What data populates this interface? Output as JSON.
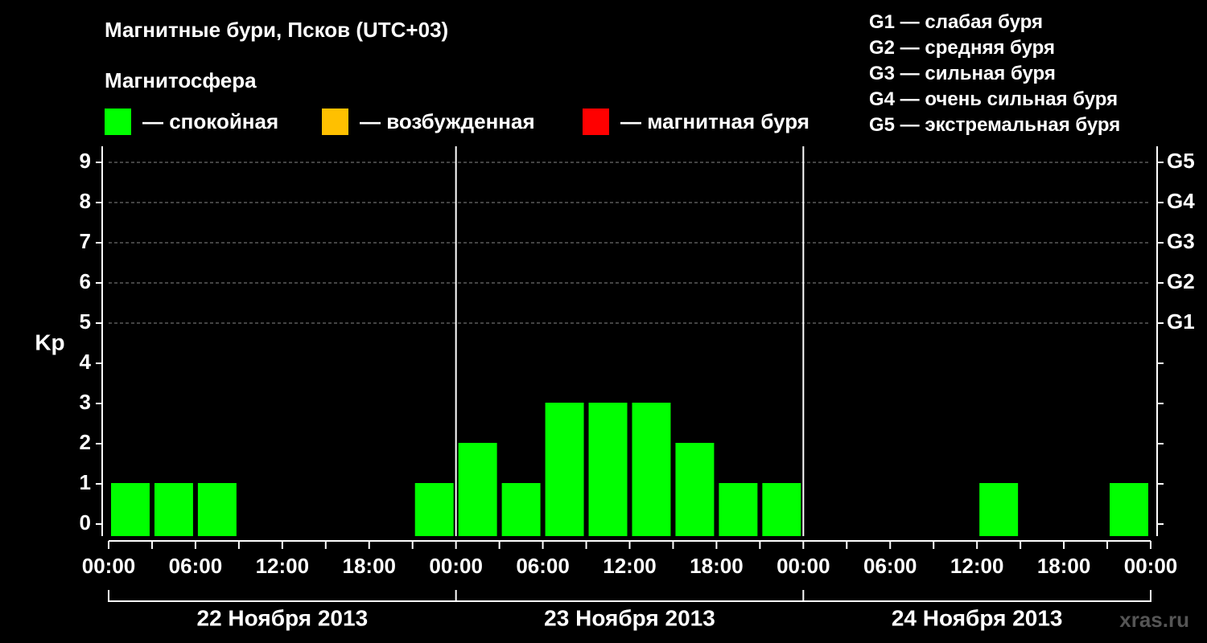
{
  "chart_data": {
    "type": "bar",
    "title": "Магнитные бури, Псков (UTC+03)",
    "subtitle": "Магнитосфера",
    "ylabel": "Kp",
    "ylim": [
      0,
      9
    ],
    "y_ticks": [
      "0",
      "1",
      "2",
      "3",
      "4",
      "5",
      "6",
      "7",
      "8",
      "9"
    ],
    "right_axis_labels": [
      {
        "kp": 5,
        "label": "G1"
      },
      {
        "kp": 6,
        "label": "G2"
      },
      {
        "kp": 7,
        "label": "G3"
      },
      {
        "kp": 8,
        "label": "G4"
      },
      {
        "kp": 9,
        "label": "G5"
      }
    ],
    "x_tick_labels": [
      "00:00",
      "06:00",
      "12:00",
      "18:00",
      "00:00",
      "06:00",
      "12:00",
      "18:00",
      "00:00",
      "06:00",
      "12:00",
      "18:00",
      "00:00"
    ],
    "days": [
      "22 Ноября 2013",
      "23 Ноября 2013",
      "24 Ноября 2013"
    ],
    "interval_hours": 3,
    "values": [
      1,
      1,
      1,
      0,
      0,
      0,
      0,
      1,
      2,
      1,
      3,
      3,
      3,
      2,
      1,
      1,
      0,
      0,
      0,
      0,
      1,
      0,
      0,
      1
    ],
    "colors": {
      "calm": "#00ff00",
      "excited": "#ffc000",
      "storm": "#ff0000"
    },
    "grid": "dashed-horizontal"
  },
  "legend": [
    {
      "color": "#00ff00",
      "label": "— спокойная"
    },
    {
      "color": "#ffc000",
      "label": "— возбужденная"
    },
    {
      "color": "#ff0000",
      "label": "— магнитная буря"
    }
  ],
  "g_scale": [
    "G1 — слабая буря",
    "G2 — средняя буря",
    "G3 — сильная буря",
    "G4 — очень сильная буря",
    "G5 — экстремальная буря"
  ],
  "watermark": "xras.ru"
}
